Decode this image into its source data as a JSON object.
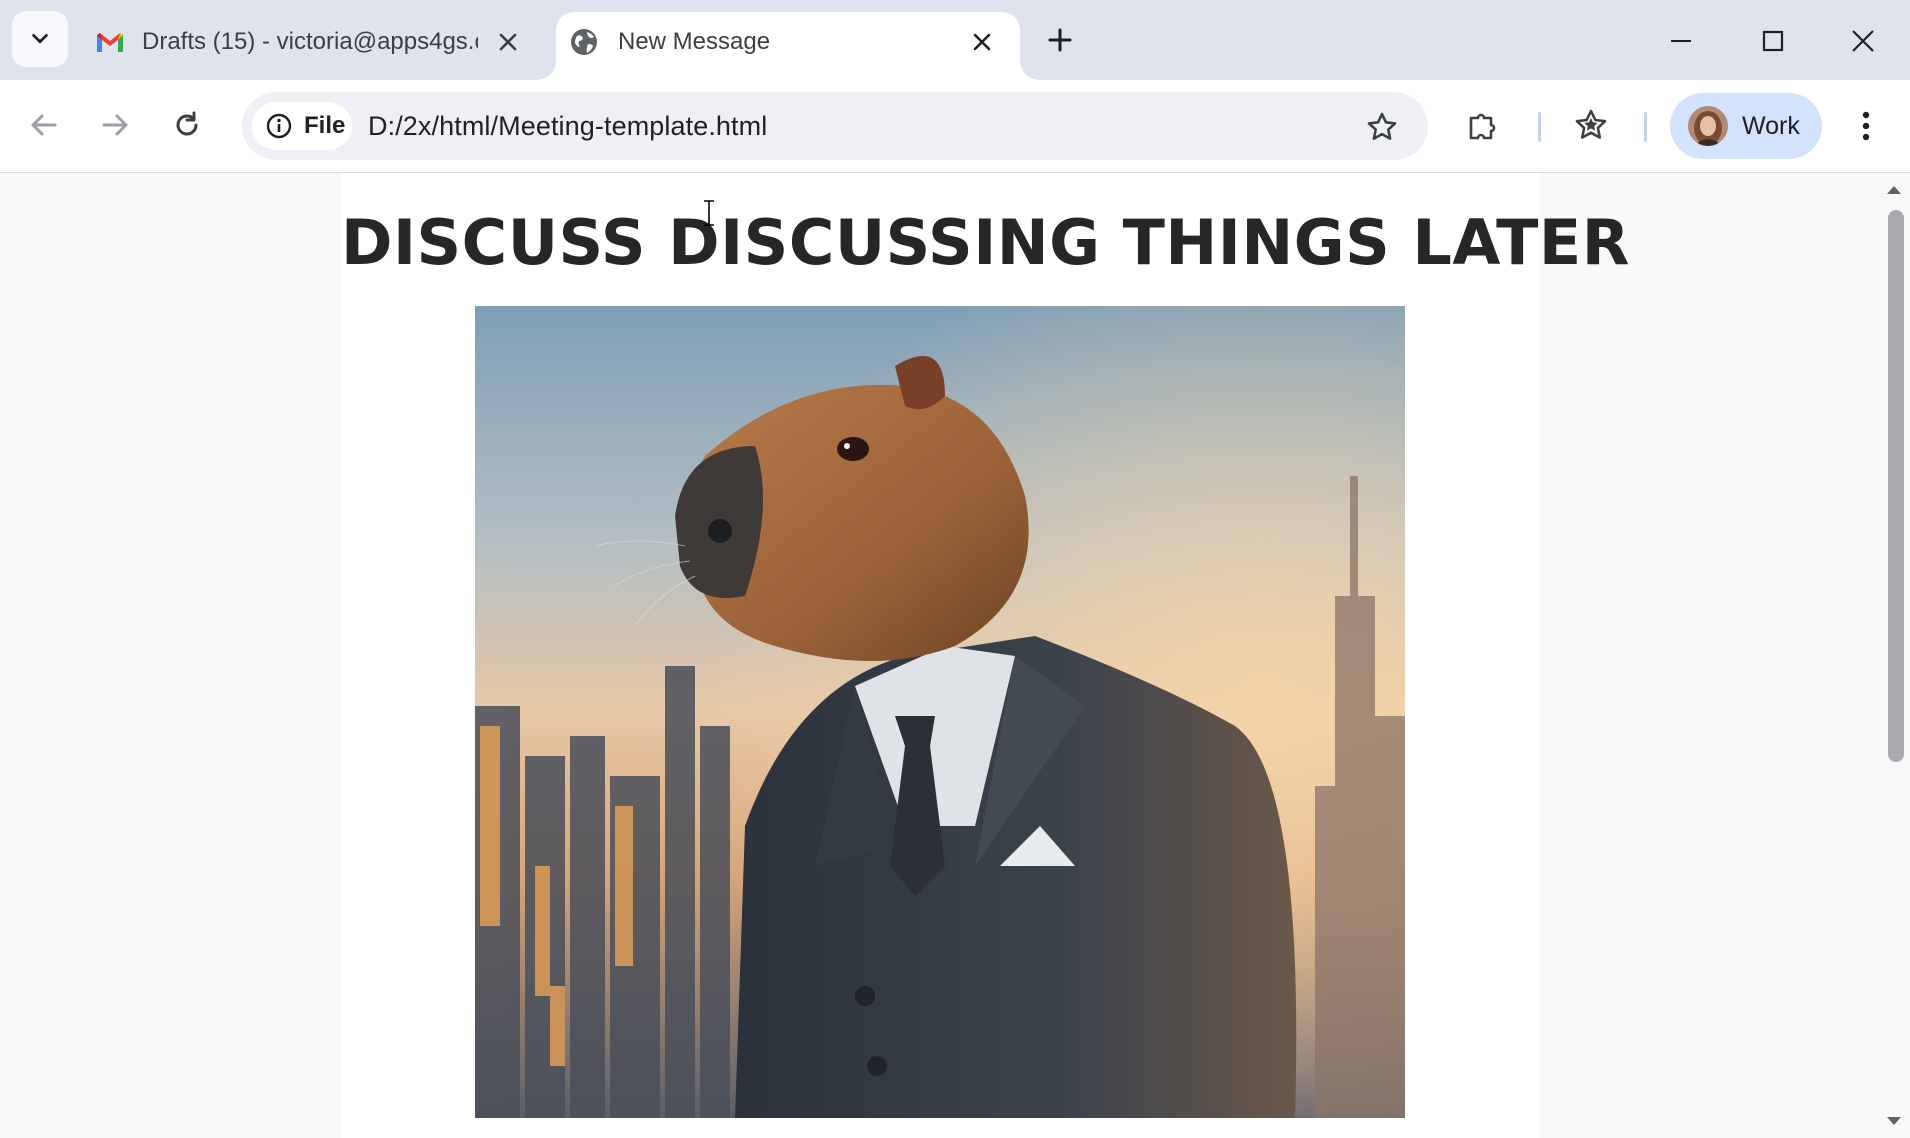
{
  "browser": {
    "tabs": [
      {
        "title": "Drafts (15) - victoria@apps4gs.c",
        "icon": "gmail-icon",
        "active": false
      },
      {
        "title": "New Message",
        "icon": "globe-icon",
        "active": true
      }
    ],
    "address": {
      "chip_label": "File",
      "url": "D:/2x/html/Meeting-template.html"
    },
    "profile_name": "Work",
    "colors": {
      "tabstrip_bg": "#dfe3ee",
      "active_tab_bg": "#ffffff",
      "omnibox_bg": "#eef0f6",
      "profile_chip_bg": "#d3e3fd"
    }
  },
  "page": {
    "headline": "DISCUSS DISCUSSING THINGS LATER",
    "image_description_icon": "capybara-in-suit-photo",
    "text_color": "#262626"
  }
}
